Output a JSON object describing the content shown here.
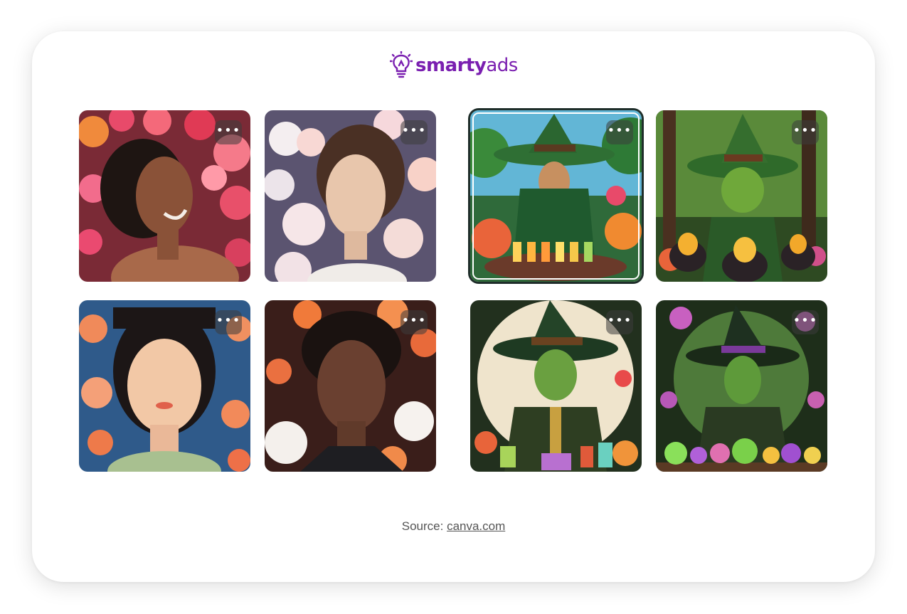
{
  "brand": {
    "name_bold": "smarty",
    "name_light": "ads",
    "color": "#7a1fb0"
  },
  "tiles": [
    {
      "name": "portrait-woman-pink-flowers",
      "more_label": "•••",
      "selected": false
    },
    {
      "name": "portrait-woman-white-flowers",
      "more_label": "•••",
      "selected": false
    },
    {
      "name": "wizard-lit-bottles",
      "more_label": "•••",
      "selected": true
    },
    {
      "name": "goblin-witch-cauldrons",
      "more_label": "•••",
      "selected": false
    },
    {
      "name": "illustrated-woman-orange-flowers",
      "more_label": "•••",
      "selected": false
    },
    {
      "name": "illustrated-woman-daisies",
      "more_label": "•••",
      "selected": false
    },
    {
      "name": "green-wizard-potions",
      "more_label": "•••",
      "selected": false
    },
    {
      "name": "green-witch-potions",
      "more_label": "•••",
      "selected": false
    }
  ],
  "footer": {
    "source_prefix": "Source:",
    "source_link": "canva.com"
  },
  "icons": {
    "logo": "lightbulb-icon",
    "more": "more-options-icon"
  }
}
